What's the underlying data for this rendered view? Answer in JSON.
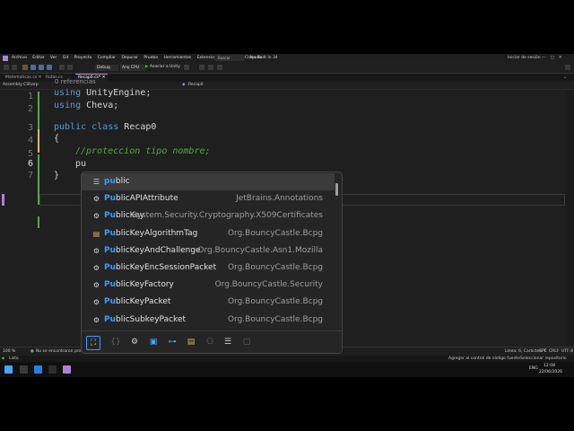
{
  "titlebar": {
    "menu": [
      "Archivo",
      "Editar",
      "Ver",
      "Git",
      "Proyecto",
      "Compilar",
      "Depurar",
      "Prueba",
      "Herramientas",
      "Extensiones",
      "Ventana",
      "Ayuda"
    ],
    "search": "Buscar",
    "solution": "Clase Built In 34",
    "signin": "Iniciar de sesión"
  },
  "toolbar": {
    "config": "Debug",
    "platform": "Any CPU",
    "attach": "Asociar a Unity"
  },
  "tabs": [
    "Matematicas.cs",
    "Rutas.cs",
    "Recap0.cs*"
  ],
  "navbar": {
    "project": "Assembly-CSharp",
    "type": "Recap0"
  },
  "editor": {
    "line_numbers": [
      "1",
      "2",
      "3",
      "4",
      "5",
      "6",
      "7"
    ],
    "codelens": "0 referencias",
    "lines": {
      "l1_kw": "using",
      "l1_rest": " UnityEngine;",
      "l2_kw": "using",
      "l2_rest": " Cheva;",
      "l3_kw": "public class",
      "l3_rest": " Recap0",
      "l4": "{",
      "l5": "//proteccion tipo nombre;",
      "l6": "pu",
      "l7": "}"
    }
  },
  "completion": {
    "items": [
      {
        "match": "pu",
        "rest": "blic",
        "ns": "",
        "icon": "keyword-icon"
      },
      {
        "match": "Pu",
        "rest": "blicAPIAttribute",
        "ns": "JetBrains.Annotations",
        "icon": "class-icon"
      },
      {
        "match": "Pu",
        "rest": "blicKey",
        "ns": "System.Security.Cryptography.X509Certificates",
        "icon": "class-icon"
      },
      {
        "match": "Pu",
        "rest": "blicKeyAlgorithmTag",
        "ns": "Org.BouncyCastle.Bcpg",
        "icon": "enum-icon"
      },
      {
        "match": "Pu",
        "rest": "blicKeyAndChallenge",
        "ns": "Org.BouncyCastle.Asn1.Mozilla",
        "icon": "class-icon"
      },
      {
        "match": "Pu",
        "rest": "blicKeyEncSessionPacket",
        "ns": "Org.BouncyCastle.Bcpg",
        "icon": "class-icon"
      },
      {
        "match": "Pu",
        "rest": "blicKeyFactory",
        "ns": "Org.BouncyCastle.Security",
        "icon": "class-icon"
      },
      {
        "match": "Pu",
        "rest": "blicKeyPacket",
        "ns": "Org.BouncyCastle.Bcpg",
        "icon": "class-icon"
      },
      {
        "match": "Pu",
        "rest": "blicSubkeyPacket",
        "ns": "Org.BouncyCastle.Bcpg",
        "icon": "class-icon"
      }
    ]
  },
  "status": {
    "zoom": "100 %",
    "issues": "No se encontraron problemas.",
    "position": "Línea: 6, Carácter: 7",
    "spc": "SPC",
    "eol": "CRLF",
    "encoding": "UTF-8"
  },
  "output": {
    "ready": "Listo",
    "source": "Agregar al control de código fuente",
    "repo": "Seleccionar repositorio"
  },
  "taskbar": {
    "lang": "ENG",
    "time": "12:08",
    "date": "22/06/2026"
  },
  "colors": {
    "accent": "#b180d7",
    "keyword": "#569cd6",
    "comment": "#57a64a",
    "match": "#3b9cff"
  }
}
